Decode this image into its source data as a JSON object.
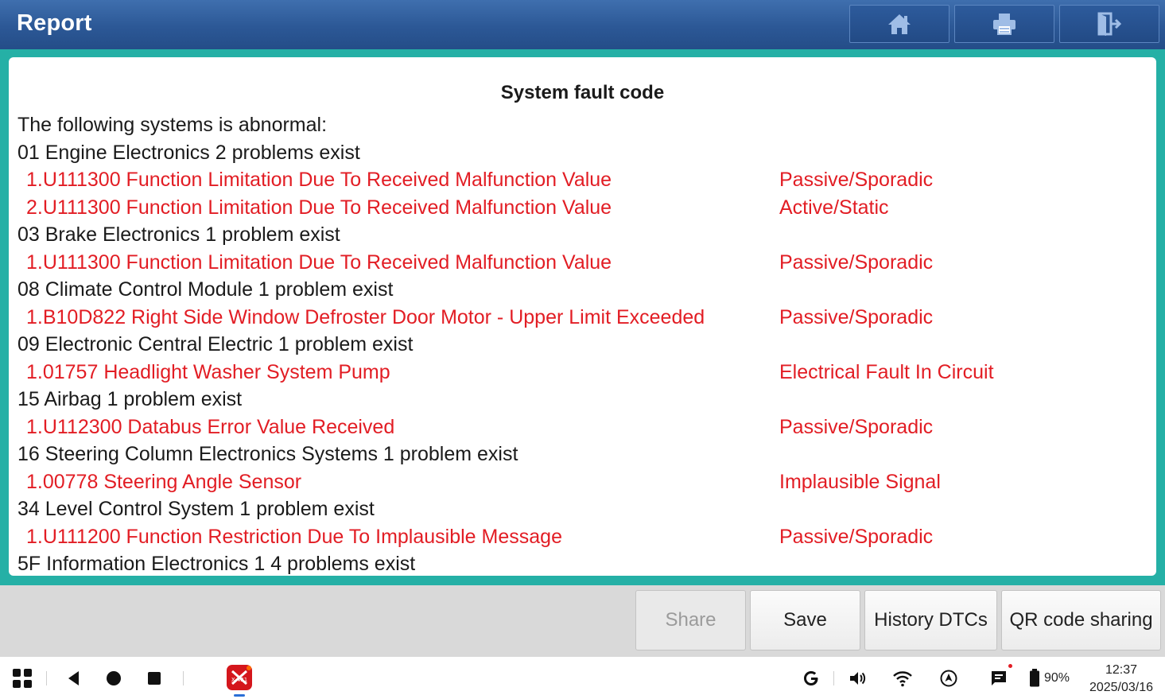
{
  "header": {
    "title": "Report",
    "buttons": [
      {
        "name": "home-button",
        "icon": "home-icon"
      },
      {
        "name": "print-button",
        "icon": "printer-icon"
      },
      {
        "name": "exit-button",
        "icon": "exit-door-icon"
      }
    ]
  },
  "report": {
    "heading": "System fault code",
    "intro": "The following systems is abnormal:",
    "lines": [
      {
        "type": "system",
        "text": "01 Engine Electronics 2 problems exist"
      },
      {
        "type": "fault",
        "code": "1.U111300 Function Limitation Due To Received Malfunction Value",
        "status": "Passive/Sporadic"
      },
      {
        "type": "fault",
        "code": "2.U111300 Function Limitation Due To Received Malfunction Value",
        "status": "Active/Static"
      },
      {
        "type": "system",
        "text": "03 Brake Electronics 1 problem exist"
      },
      {
        "type": "fault",
        "code": "1.U111300 Function Limitation Due To Received Malfunction Value",
        "status": "Passive/Sporadic"
      },
      {
        "type": "system",
        "text": "08 Climate Control Module 1 problem exist"
      },
      {
        "type": "fault",
        "code": "1.B10D822 Right Side Window Defroster Door Motor - Upper Limit Exceeded",
        "status": "Passive/Sporadic"
      },
      {
        "type": "system",
        "text": "09 Electronic Central Electric 1 problem exist"
      },
      {
        "type": "fault",
        "code": "1.01757 Headlight Washer System Pump",
        "status": "Electrical Fault In Circuit"
      },
      {
        "type": "system",
        "text": "15 Airbag 1 problem exist"
      },
      {
        "type": "fault",
        "code": "1.U112300 Databus Error Value Received",
        "status": "Passive/Sporadic"
      },
      {
        "type": "system",
        "text": "16 Steering Column Electronics Systems 1 problem exist"
      },
      {
        "type": "fault",
        "code": "1.00778 Steering Angle Sensor",
        "status": "Implausible Signal"
      },
      {
        "type": "system",
        "text": "34 Level Control System 1 problem exist"
      },
      {
        "type": "fault",
        "code": "1.U111200 Function Restriction Due To Implausible Message",
        "status": "Passive/Sporadic"
      },
      {
        "type": "system",
        "text": "5F Information Electronics 1 4 problems exist"
      }
    ]
  },
  "actions": {
    "share": "Share",
    "save": "Save",
    "history": "History DTCs",
    "qr": "QR code sharing"
  },
  "statusbar": {
    "battery": "90%",
    "time": "12:37",
    "date": "2025/03/16",
    "app_label": "X-431"
  },
  "colors": {
    "header": "#2c5896",
    "frame": "#25b0a6",
    "fault_text": "#e21d24",
    "actionbar": "#d9d9d9"
  }
}
